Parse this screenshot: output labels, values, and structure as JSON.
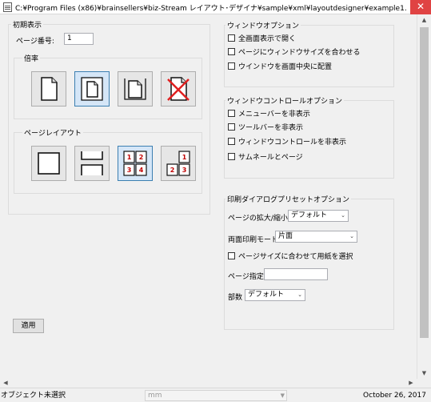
{
  "window": {
    "title": "C:¥Program Files (x86)¥brainsellers¥biz-Stream レイアウト･デザイナ¥sample¥xml¥layoutdesigner¥example1...",
    "close_glyph": "✕"
  },
  "initial_display": {
    "group_label": "初期表示",
    "page_number_label": "ページ番号:",
    "page_number_value": "1",
    "zoom": {
      "group_label": "倍率",
      "buttons": [
        {
          "name": "zoom-fit-width-icon",
          "selected": false
        },
        {
          "name": "zoom-fit-page-icon",
          "selected": true
        },
        {
          "name": "zoom-actual-size-icon",
          "selected": false
        },
        {
          "name": "zoom-none-icon",
          "selected": false
        }
      ]
    },
    "page_layout": {
      "group_label": "ページレイアウト",
      "buttons": [
        {
          "name": "layout-single-page-icon",
          "selected": false
        },
        {
          "name": "layout-continuous-icon",
          "selected": false
        },
        {
          "name": "layout-two-page-icon",
          "selected": true,
          "numbers": [
            "1",
            "2",
            "3",
            "4"
          ]
        },
        {
          "name": "layout-two-page-cover-icon",
          "selected": false,
          "numbers": [
            "1",
            "2",
            "3"
          ]
        }
      ]
    }
  },
  "window_options": {
    "group_label": "ウィンドウオプション",
    "items": [
      {
        "label": "全画面表示で開く",
        "checked": false
      },
      {
        "label": "ページにウィンドウサイズを合わせる",
        "checked": false
      },
      {
        "label": "ウインドウを画面中央に配置",
        "checked": false
      }
    ]
  },
  "window_control_options": {
    "group_label": "ウィンドウコントロールオプション",
    "items": [
      {
        "label": "メニューバーを非表示",
        "checked": false
      },
      {
        "label": "ツールバーを非表示",
        "checked": false
      },
      {
        "label": "ウィンドウコントロールを非表示",
        "checked": false
      },
      {
        "label": "サムネールとページ",
        "checked": false
      }
    ]
  },
  "print_dialog_options": {
    "group_label": "印刷ダイアログプリセットオプション",
    "scale_label": "ページの拡大/縮小",
    "scale_value": "デフォルト",
    "duplex_label": "両面印刷モード",
    "duplex_value": "片面",
    "paper_by_size_label": "ページサイズに合わせて用紙を選択",
    "paper_by_size_checked": false,
    "page_range_label": "ページ指定",
    "page_range_value": "",
    "copies_label": "部数",
    "copies_value": "デフォルト"
  },
  "apply_button_label": "適用",
  "scrollbar": {
    "up_glyph": "▲",
    "down_glyph": "▼",
    "left_glyph": "◀",
    "right_glyph": "▶"
  },
  "statusbar": {
    "object_status": "オブジェクト未選択",
    "unit_value": "mm",
    "dropdown_glyph": "▼",
    "date": "October 26, 2017"
  },
  "colors": {
    "selection_border": "#3c7fb1",
    "red_number": "#c00000",
    "red_cross": "#e02020"
  }
}
